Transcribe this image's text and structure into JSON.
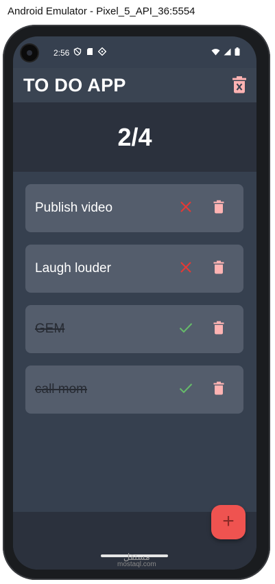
{
  "window": {
    "title": "Android Emulator - Pixel_5_API_36:5554"
  },
  "status_bar": {
    "time": "2:56"
  },
  "app_bar": {
    "title": "TO DO APP",
    "clear_icon": "delete-sweep-icon"
  },
  "counter": {
    "text": "2/4",
    "completed": 2,
    "total": 4
  },
  "tasks": [
    {
      "title": "Publish video",
      "done": false
    },
    {
      "title": "Laugh louder",
      "done": false
    },
    {
      "title": "GEM",
      "done": true
    },
    {
      "title": "call mom",
      "done": true
    }
  ],
  "fab": {
    "label": "+"
  },
  "watermark": {
    "arabic": "مستقل",
    "latin": "mostaql.com"
  },
  "colors": {
    "screen_bg": "#36404f",
    "panel_bg": "#2b313d",
    "card_bg": "#545d6c",
    "undo_icon": "#e53935",
    "done_icon": "#66bb6a",
    "delete_icon": "#ffb3b3",
    "fab": "#ef5350"
  }
}
